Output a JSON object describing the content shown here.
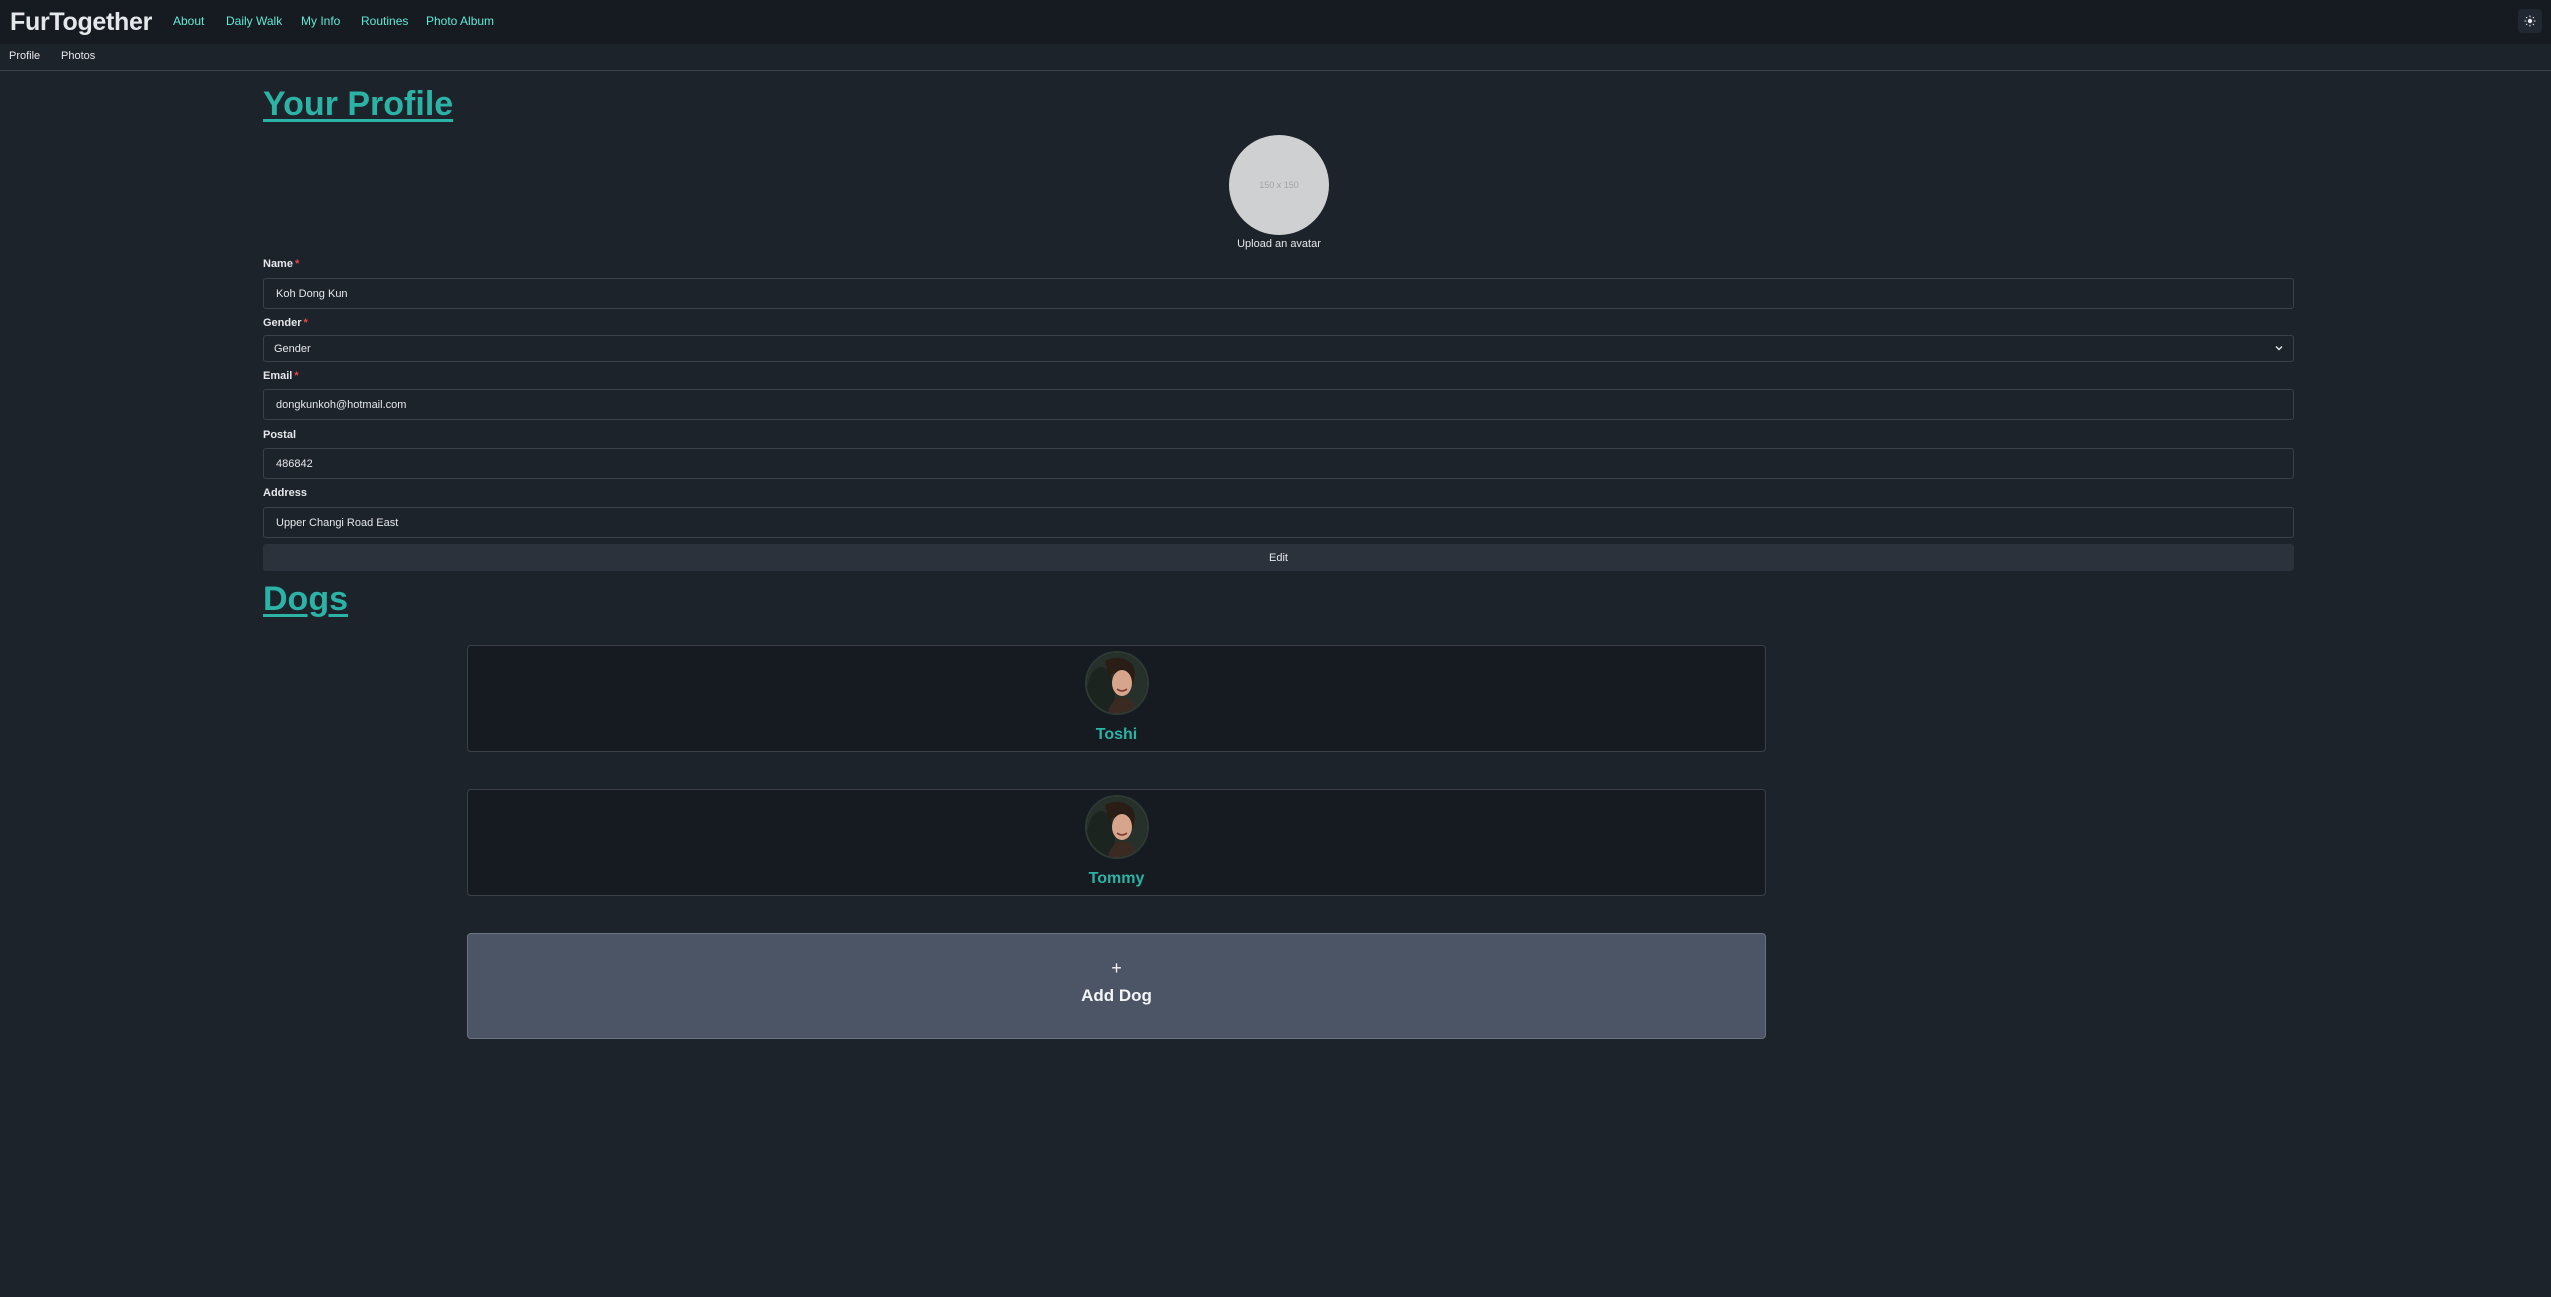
{
  "header": {
    "brand": "FurTogether",
    "nav": [
      "About",
      "Daily Walk",
      "My Info",
      "Routines",
      "Photo Album"
    ],
    "theme_icon": "sun-icon"
  },
  "subnav": [
    "Profile",
    "Photos"
  ],
  "profile": {
    "title": "Your Profile",
    "avatar_placeholder": "150 x 150",
    "avatar_caption": "Upload an avatar",
    "fields": {
      "name": {
        "label": "Name",
        "required": true,
        "value": "Koh Dong Kun"
      },
      "gender": {
        "label": "Gender",
        "required": true,
        "value": "Gender"
      },
      "email": {
        "label": "Email",
        "required": true,
        "value": "dongkunkoh@hotmail.com"
      },
      "postal": {
        "label": "Postal",
        "required": false,
        "value": "486842"
      },
      "address": {
        "label": "Address",
        "required": false,
        "value": "Upper Changi Road East"
      }
    },
    "edit_label": "Edit",
    "required_mark": "*"
  },
  "dogs": {
    "title": "Dogs",
    "items": [
      {
        "name": "Toshi"
      },
      {
        "name": "Tommy"
      }
    ],
    "add_icon": "+",
    "add_label": "Add Dog"
  },
  "colors": {
    "accent": "#2bb3a6",
    "nav_link": "#5eead4",
    "background": "#1d232a",
    "header": "#161b22",
    "add_card": "#4b5565"
  }
}
